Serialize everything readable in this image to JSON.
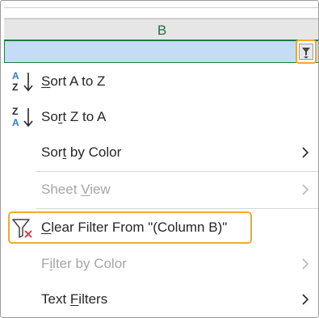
{
  "column_header": {
    "label": "B"
  },
  "filter_button": {
    "icon": "filter-dropdown-icon"
  },
  "menu": {
    "items": [
      {
        "id": "sort-a-z",
        "prefix": "",
        "accel": "S",
        "rest": "ort A to Z",
        "icon": "sort-a-to-z-icon",
        "disabled": false,
        "submenu": false
      },
      {
        "id": "sort-z-a",
        "prefix": "So",
        "accel": "r",
        "rest": "t Z to A",
        "icon": "sort-z-to-a-icon",
        "disabled": false,
        "submenu": false
      },
      {
        "id": "sort-by-color",
        "prefix": "Sor",
        "accel": "t",
        "rest": " by Color",
        "icon": "",
        "disabled": false,
        "submenu": true
      },
      {
        "id": "sheet-view",
        "prefix": "Sheet ",
        "accel": "V",
        "rest": "iew",
        "icon": "",
        "disabled": true,
        "submenu": true
      },
      {
        "id": "clear-filter",
        "prefix": "",
        "accel": "C",
        "rest": "lear Filter From \"(Column B)\"",
        "icon": "clear-filter-icon",
        "disabled": false,
        "submenu": false
      },
      {
        "id": "filter-by-color",
        "prefix": "F",
        "accel": "i",
        "rest": "lter by Color",
        "icon": "",
        "disabled": true,
        "submenu": true
      },
      {
        "id": "text-filters",
        "prefix": "",
        "accel": "",
        "rest": "",
        "full": "Text Filters",
        "icon": "",
        "disabled": false,
        "submenu": true
      }
    ]
  },
  "colors": {
    "accent_highlight": "#f0a930",
    "selected_cell": "#c5dcf7",
    "excel_green": "#217346",
    "sort_blue": "#2b7cd3",
    "clear_red": "#d13438"
  }
}
